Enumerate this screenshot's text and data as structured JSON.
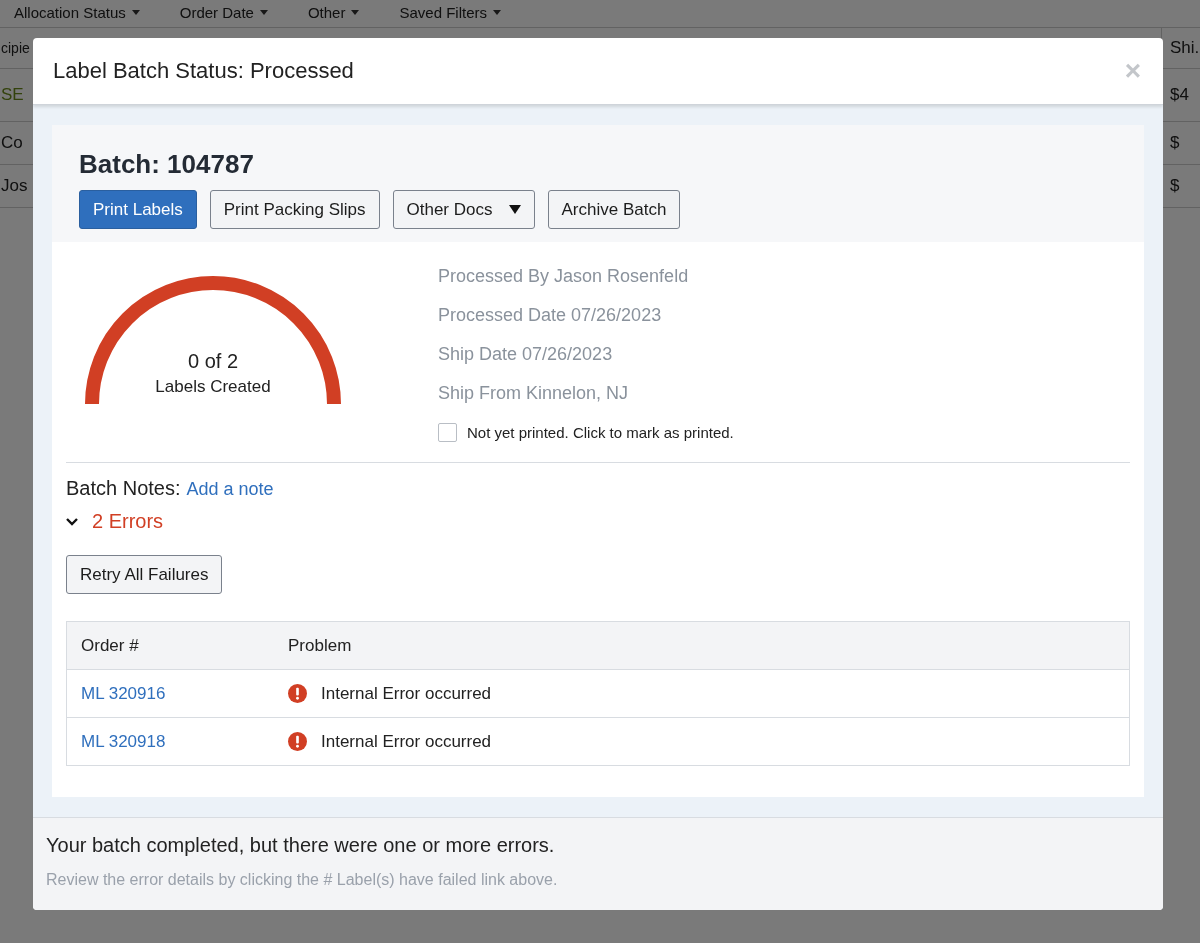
{
  "background": {
    "filters": [
      "Allocation Status",
      "Order Date",
      "Other",
      "Saved Filters"
    ],
    "table": {
      "columns": [
        "cipie",
        "Shi."
      ],
      "rows": [
        {
          "cells": [
            "SE",
            "$4"
          ],
          "kind": "highlight"
        },
        {
          "cells": [
            "Co",
            "$"
          ],
          "kind": "plain"
        },
        {
          "cells": [
            "Jos",
            "$"
          ],
          "kind": "plain"
        }
      ]
    }
  },
  "modal": {
    "title": "Label Batch Status: Processed",
    "close": "×",
    "batch_title": "Batch: 104787",
    "buttons": [
      {
        "label": "Print Labels",
        "kind": "primary"
      },
      {
        "label": "Print Packing Slips",
        "kind": "default"
      },
      {
        "label": "Other Docs",
        "kind": "dropdown"
      },
      {
        "label": "Archive Batch",
        "kind": "default"
      }
    ],
    "gauge": {
      "count": "0 of 2",
      "caption": "Labels Created"
    },
    "details": [
      "Processed By Jason Rosenfeld",
      "Processed Date 07/26/2023",
      "Ship Date 07/26/2023",
      "Ship From Kinnelon, NJ"
    ],
    "printed": {
      "label": "Not yet printed. Click to mark as printed.",
      "checked": false
    },
    "notes": {
      "label": "Batch Notes:",
      "link": "Add a note"
    },
    "errors": {
      "label": "2 Errors",
      "expanded": true
    },
    "retry_button": "Retry All Failures",
    "table": {
      "columns": [
        "Order #",
        "Problem"
      ],
      "rows": [
        {
          "order": "ML 320916",
          "problem": "Internal Error occurred"
        },
        {
          "order": "ML 320918",
          "problem": "Internal Error occurred"
        }
      ]
    },
    "footer": {
      "message": "Your batch completed, but there were one or more errors.",
      "hint": "Review the error details by clicking the # Label(s) have failed link above."
    }
  }
}
